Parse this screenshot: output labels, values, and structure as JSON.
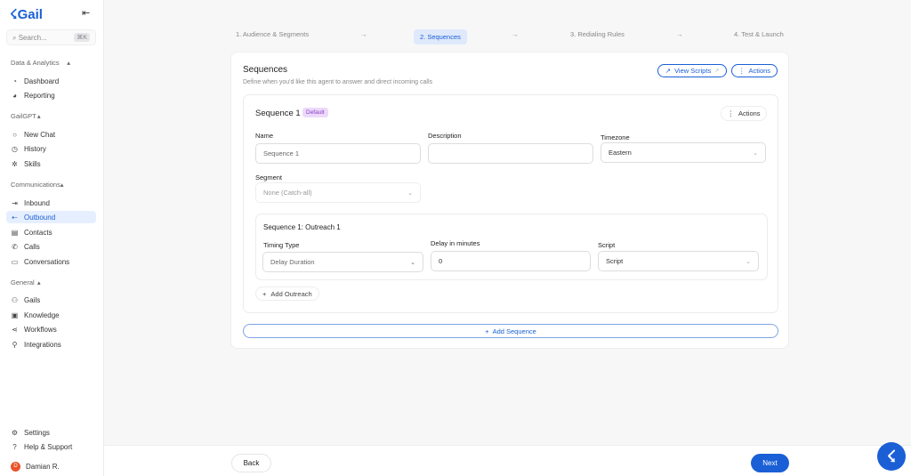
{
  "sidebar": {
    "logo": "Gail",
    "search_placeholder": "Search...",
    "search_shortcut": "⌘K",
    "sections": [
      {
        "title": "Data & Analytics",
        "items": [
          {
            "label": "Dashboard",
            "icon": "gauge-icon"
          },
          {
            "label": "Reporting",
            "icon": "pie-chart-icon"
          }
        ]
      },
      {
        "title": "GailGPT",
        "items": [
          {
            "label": "New Chat",
            "icon": "chat-bubble-icon"
          },
          {
            "label": "History",
            "icon": "clock-icon"
          },
          {
            "label": "Skills",
            "icon": "puzzle-icon"
          }
        ]
      },
      {
        "title": "Communications",
        "items": [
          {
            "label": "Inbound",
            "icon": "inbound-icon"
          },
          {
            "label": "Outbound",
            "icon": "outbound-icon"
          },
          {
            "label": "Contacts",
            "icon": "contact-card-icon"
          },
          {
            "label": "Calls",
            "icon": "phone-icon"
          },
          {
            "label": "Conversations",
            "icon": "message-square-icon"
          }
        ]
      },
      {
        "title": "General",
        "items": [
          {
            "label": "Gails",
            "icon": "agent-icon"
          },
          {
            "label": "Knowledge",
            "icon": "book-icon"
          },
          {
            "label": "Workflows",
            "icon": "workflow-icon"
          },
          {
            "label": "Integrations",
            "icon": "wrench-icon"
          }
        ]
      }
    ],
    "settings": "Settings",
    "help": "Help & Support",
    "user": {
      "name": "Damian R.",
      "initial": "D"
    }
  },
  "steps": [
    "1. Audience & Segments",
    "2. Sequences",
    "3. Redialing Rules",
    "4. Test & Launch"
  ],
  "card": {
    "title": "Sequences",
    "subtitle": "Define when you'd like this agent to answer and direct incoming calls",
    "view_scripts": "View Scripts",
    "actions": "Actions",
    "sequence": {
      "title": "Sequence 1",
      "badge": "Default",
      "actions": "Actions",
      "name_label": "Name",
      "name_value": "Sequence 1",
      "description_label": "Description",
      "description_value": "",
      "timezone_label": "Timezone",
      "timezone_value": "Eastern",
      "segment_label": "Segment",
      "segment_value": "None (Catch-all)",
      "outreach": {
        "title": "Sequence 1: Outreach 1",
        "timing_label": "Timing Type",
        "timing_value": "Delay Duration",
        "delay_label": "Delay in minutes",
        "delay_value": "0",
        "script_label": "Script",
        "script_value": "Script"
      },
      "add_outreach": "Add Outreach"
    },
    "add_sequence": "Add Sequence"
  },
  "footer": {
    "back": "Back",
    "next": "Next"
  },
  "colors": {
    "accent": "#1a5fd6",
    "badge_bg": "#ecd9fb"
  }
}
